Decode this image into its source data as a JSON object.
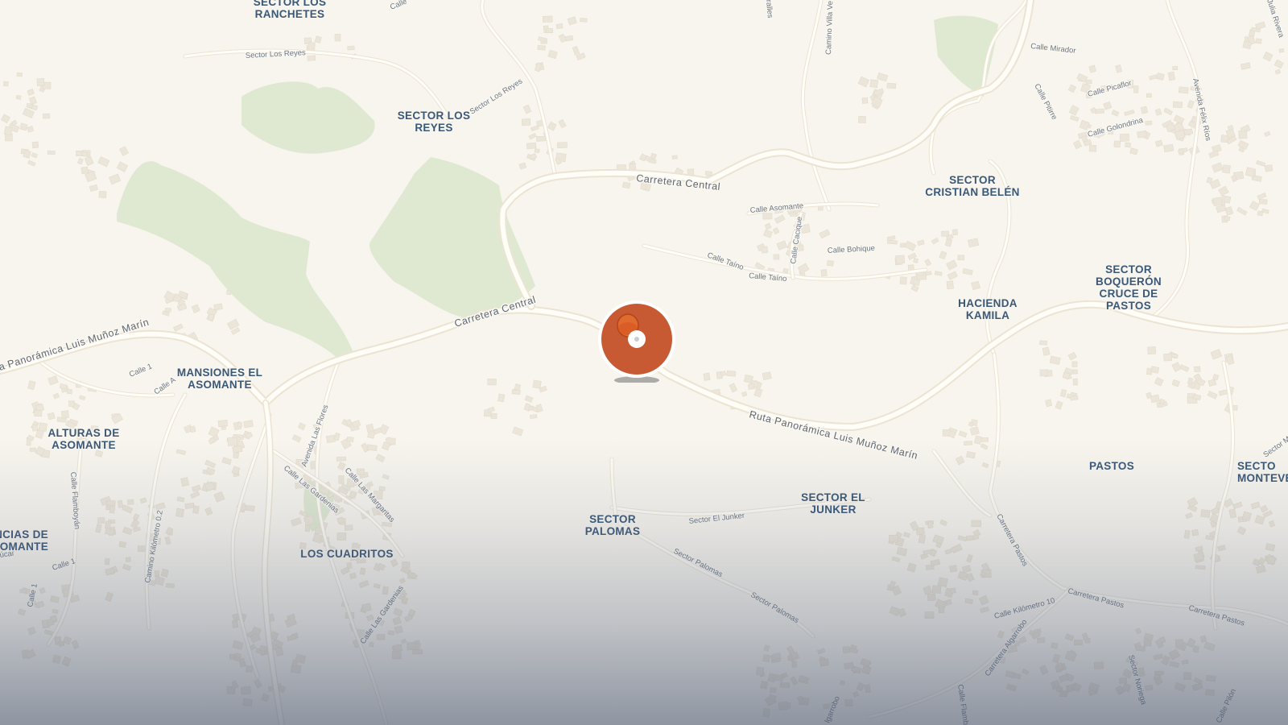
{
  "map": {
    "colors": {
      "background": "#f8f5ee",
      "park": "#dfe9d2",
      "road": "#fffdf7",
      "road_casing": "#ece4d2",
      "place_label": "#3a5878",
      "street_label": "#6b7683",
      "marker": "#c75a32",
      "marker_ring": "#ffffff"
    },
    "marker": {
      "name": "current-location-marker",
      "icon": "pin-icon"
    },
    "place_labels": [
      {
        "name": "sector-los-ranchetes",
        "lines": [
          "SECTOR LOS",
          "RANCHETES"
        ]
      },
      {
        "name": "sector-los-reyes",
        "lines": [
          "SECTOR LOS",
          "REYES"
        ]
      },
      {
        "name": "sector-cristian-belen",
        "lines": [
          "SECTOR",
          "CRISTIAN BELÉN"
        ]
      },
      {
        "name": "sector-boqueron-cruce-de-pastos",
        "lines": [
          "SECTOR",
          "BOQUERÓN",
          "CRUCE DE",
          "PASTOS"
        ]
      },
      {
        "name": "hacienda-kamila",
        "lines": [
          "HACIENDA",
          "KAMILA"
        ]
      },
      {
        "name": "mansiones-el-asomante",
        "lines": [
          "MANSIONES EL",
          "ASOMANTE"
        ]
      },
      {
        "name": "alturas-de-asomante",
        "lines": [
          "ALTURAS DE",
          "ASOMANTE"
        ]
      },
      {
        "name": "pastos",
        "lines": [
          "PASTOS"
        ]
      },
      {
        "name": "sector-montevideo",
        "lines": [
          "SECTO",
          "MONTEVE"
        ]
      },
      {
        "name": "sector-el-junker",
        "lines": [
          "SECTOR EL",
          "JUNKER"
        ]
      },
      {
        "name": "sector-palomas",
        "lines": [
          "SECTOR",
          "PALOMAS"
        ]
      },
      {
        "name": "los-cuadritos",
        "lines": [
          "LOS CUADRITOS"
        ]
      },
      {
        "name": "residencias-de-asomante",
        "lines": [
          "NCIAS DE",
          "OMANTE"
        ]
      }
    ],
    "major_road_labels": [
      {
        "name": "carretera-central-east",
        "text": "Carretera Central"
      },
      {
        "name": "carretera-central-west",
        "text": "Carretera Central"
      },
      {
        "name": "ruta-panoramica-east",
        "text": "Ruta Panorámica Luis Muñoz Marín"
      },
      {
        "name": "ruta-panoramica-west",
        "text": "a Panorámica Luis Muñoz Marín"
      }
    ],
    "street_labels": [
      {
        "name": "sector-los-reyes-road",
        "text": "Sector Los Reyes"
      },
      {
        "name": "sector-los-reyes-road-2",
        "text": "Sector Los Reyes"
      },
      {
        "name": "calle-mirador",
        "text": "Calle Mirador"
      },
      {
        "name": "calle-picaflor",
        "text": "Calle Picaflor"
      },
      {
        "name": "calle-pitirre",
        "text": "Calle Pitirre"
      },
      {
        "name": "calle-golondrina",
        "text": "Calle Golondrina"
      },
      {
        "name": "avenida-felix-rios",
        "text": "Avenida Félix Ríos"
      },
      {
        "name": "calle-asomante",
        "text": "Calle Asomante"
      },
      {
        "name": "calle-cacique",
        "text": "Calle Cacique"
      },
      {
        "name": "calle-bohique",
        "text": "Calle Bohique"
      },
      {
        "name": "calle-taino-1",
        "text": "Calle Taíno"
      },
      {
        "name": "calle-taino-2",
        "text": "Calle Taíno"
      },
      {
        "name": "camino-villa-verde",
        "text": "Camino Villa Ve"
      },
      {
        "name": "calle-1-top",
        "text": "Calle"
      },
      {
        "name": "calle-1",
        "text": "Calle 1"
      },
      {
        "name": "calle-a",
        "text": "Calle A"
      },
      {
        "name": "avenida-las-flores",
        "text": "Avenida Las Flores"
      },
      {
        "name": "calle-las-gardenias",
        "text": "Calle Las Gardenias"
      },
      {
        "name": "calle-las-margaritas",
        "text": "Calle Las Margaritas"
      },
      {
        "name": "calle-las-gardenias-2",
        "text": "Calle Las Gardenias"
      },
      {
        "name": "calle-flamboyan",
        "text": "Calle Flamboyán"
      },
      {
        "name": "camino-kilometro",
        "text": "Camino Kilómetro 0.2"
      },
      {
        "name": "calle-1-sw",
        "text": "Calle 1"
      },
      {
        "name": "calle-1-sw-2",
        "text": "Calle 1"
      },
      {
        "name": "sector-el-junker-road",
        "text": "Sector El Junker"
      },
      {
        "name": "sector-palomas-road-1",
        "text": "Sector Palomas"
      },
      {
        "name": "sector-palomas-road-2",
        "text": "Sector Palomas"
      },
      {
        "name": "carretera-pastos-1",
        "text": "Carretera Pastos"
      },
      {
        "name": "carretera-pastos-2",
        "text": "Carretera Pastos"
      },
      {
        "name": "carretera-pastos-3",
        "text": "Carretera Pastos"
      },
      {
        "name": "calle-kilometro-10",
        "text": "Calle Kilómetro 10"
      },
      {
        "name": "carretera-algarrobo",
        "text": "Carretera Algarrobo"
      },
      {
        "name": "algarrobo-bottom",
        "text": "lgarrobo"
      },
      {
        "name": "sector-noriega",
        "text": "Sector Noriega"
      },
      {
        "name": "calle-flamb-bottom",
        "text": "Calle Flamb"
      },
      {
        "name": "calle-pilon",
        "text": "Calle Pilón"
      },
      {
        "name": "jula-rivera",
        "text": "Julia Rivera"
      },
      {
        "name": "ucar",
        "text": "úcar"
      },
      {
        "name": "fralles",
        "text": "ralles"
      },
      {
        "name": "sector-m",
        "text": "Sector M"
      }
    ]
  }
}
